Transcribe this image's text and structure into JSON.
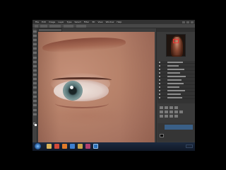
{
  "window": {
    "menu": [
      "File",
      "Edit",
      "Image",
      "Layer",
      "Type",
      "Select",
      "Filter",
      "3D",
      "View",
      "Window",
      "Help"
    ]
  },
  "status": {
    "zoom": ""
  },
  "colors": {
    "app_background": "#3c3c3c",
    "selected_layer": "#3a5f86",
    "taskbar": "#101826"
  },
  "toolbar": {
    "tools": [
      "move-tool",
      "marquee-tool",
      "lasso-tool",
      "quick-select-tool",
      "crop-tool",
      "eyedropper-tool",
      "healing-brush-tool",
      "brush-tool",
      "clone-stamp-tool",
      "history-brush-tool",
      "eraser-tool",
      "gradient-tool",
      "blur-tool",
      "dodge-tool",
      "pen-tool",
      "type-tool",
      "path-select-tool",
      "shape-tool",
      "hand-tool",
      "zoom-tool"
    ]
  },
  "taskbar": {
    "apps": [
      "explorer-icon",
      "chrome-icon",
      "firefox-icon",
      "media-icon",
      "folder-icon",
      "paint-icon",
      "photoshop-icon"
    ]
  }
}
